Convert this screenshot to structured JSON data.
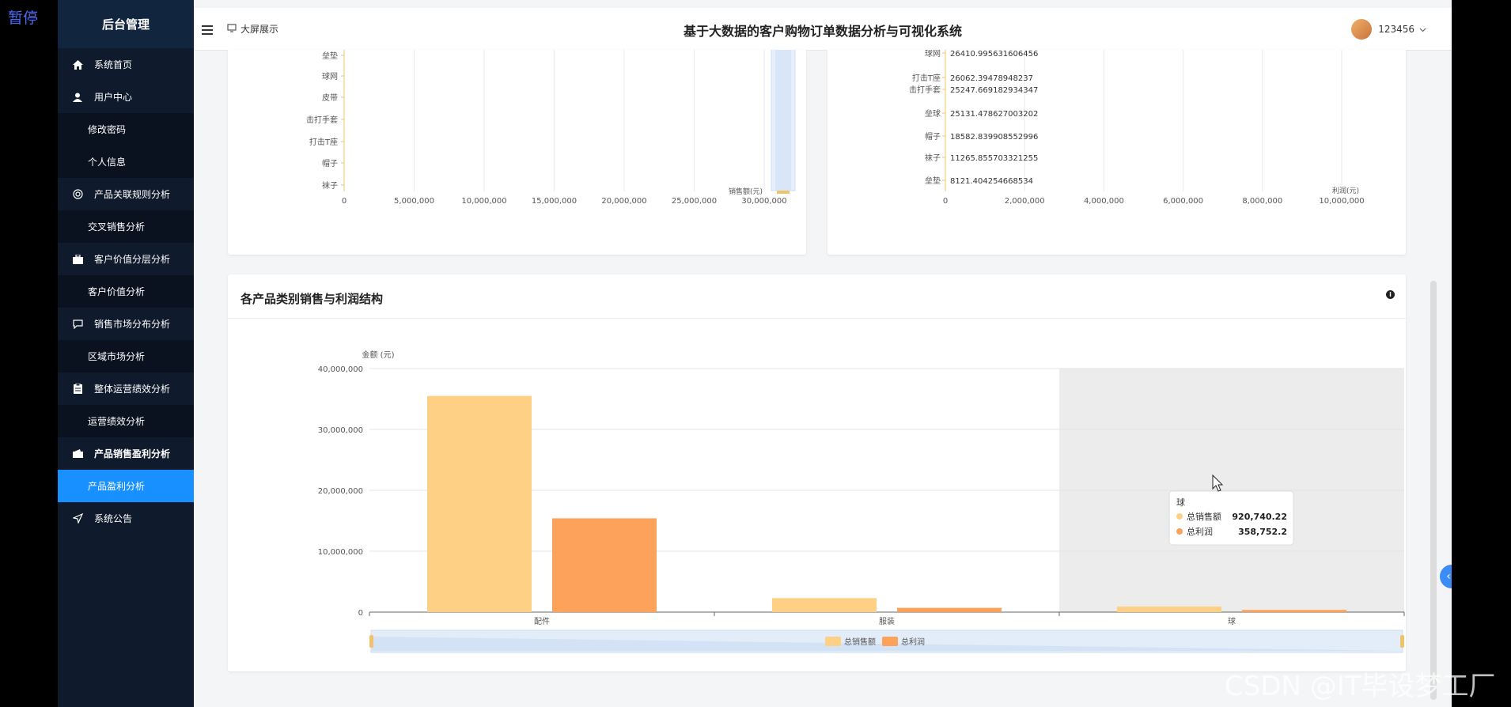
{
  "pause_label": "暂停",
  "sidebar": {
    "brand": "后台管理",
    "items": [
      {
        "label": "系统首页",
        "icon": "home-icon",
        "type": "top"
      },
      {
        "label": "用户中心",
        "icon": "user-icon",
        "type": "top"
      },
      {
        "label": "修改密码",
        "type": "sub"
      },
      {
        "label": "个人信息",
        "type": "sub"
      },
      {
        "label": "产品关联规则分析",
        "icon": "globe-icon",
        "type": "top"
      },
      {
        "label": "交叉销售分析",
        "type": "sub"
      },
      {
        "label": "客户价值分层分析",
        "icon": "briefcase-icon",
        "type": "top"
      },
      {
        "label": "客户价值分析",
        "type": "sub"
      },
      {
        "label": "销售市场分布分析",
        "icon": "chat-icon",
        "type": "top"
      },
      {
        "label": "区域市场分析",
        "type": "sub"
      },
      {
        "label": "整体运营绩效分析",
        "icon": "clipboard-icon",
        "type": "top"
      },
      {
        "label": "运营绩效分析",
        "type": "sub"
      },
      {
        "label": "产品销售盈利分析",
        "icon": "wallet-icon",
        "type": "top",
        "bold": true
      },
      {
        "label": "产品盈利分析",
        "type": "sub",
        "active": true
      },
      {
        "label": "系统公告",
        "icon": "send-icon",
        "type": "top"
      }
    ]
  },
  "header": {
    "bigscreen_label": "大屏展示",
    "title": "基于大数据的客户购物订单数据分析与可视化系统",
    "username": "123456"
  },
  "top_left_chart": {
    "categories": [
      "垒垫",
      "球网",
      "皮带",
      "击打手套",
      "打击T座",
      "帽子",
      "袜子"
    ],
    "x_ticks": [
      "0",
      "5,000,000",
      "10,000,000",
      "15,000,000",
      "20,000,000",
      "25,000,000",
      "30,000,000"
    ],
    "axis_name": "销售额(元)"
  },
  "top_right_chart": {
    "categories": [
      "球网",
      "打击T座",
      "击打手套",
      "垒球",
      "帽子",
      "袜子",
      "垒垫"
    ],
    "values": [
      26410.9956316,
      26062.39478948237,
      25247.669182934347,
      25131.478627003202,
      18582.839908552996,
      11265.855703321255,
      8121.404254668534
    ],
    "labels": [
      "26410.995631606456",
      "26062.39478948237",
      "25247.669182934347",
      "25131.478627003202",
      "18582.839908552996",
      "11265.855703321255",
      "8121.404254668534"
    ],
    "x_ticks": [
      "0",
      "2,000,000",
      "4,000,000",
      "6,000,000",
      "8,000,000",
      "10,000,000"
    ],
    "axis_name": "利润(元)"
  },
  "main_card": {
    "title": "各产品类别销售与利润结构"
  },
  "chart_data": {
    "type": "bar",
    "title": "各产品类别销售与利润结构",
    "ylabel": "金额 (元)",
    "categories": [
      "配件",
      "服装",
      "球"
    ],
    "series": [
      {
        "name": "总销售额",
        "values": [
          35500000,
          2300000,
          920740.22
        ],
        "color": "#fdd086"
      },
      {
        "name": "总利润",
        "values": [
          15400000,
          700000,
          358752.2
        ],
        "color": "#fda25a"
      }
    ],
    "ylim": [
      0,
      40000000
    ],
    "y_ticks": [
      "0",
      "10,000,000",
      "20,000,000",
      "30,000,000",
      "40,000,000"
    ],
    "grid": true,
    "legend": "bottom",
    "tooltip": {
      "category": "球",
      "rows": [
        {
          "name": "总销售额",
          "value": "920,740.22"
        },
        {
          "name": "总利润",
          "value": "358,752.2"
        }
      ]
    }
  },
  "colors": {
    "sidebar_bg": "#0f1a2c",
    "active": "#1890ff",
    "sales": "#fdd086",
    "profit": "#fda25a"
  },
  "watermark": "CSDN @IT毕设梦工厂"
}
